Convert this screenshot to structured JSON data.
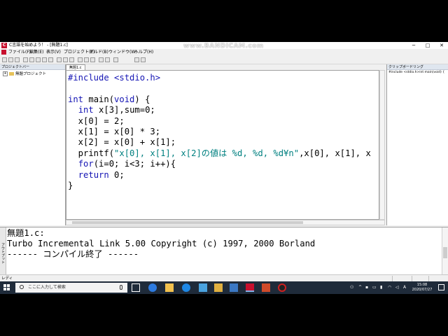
{
  "window": {
    "title": "C言語を始めよう！ - [無題1.c]",
    "app_icon_letter": "C",
    "minimize": "─",
    "maximize": "□",
    "close": "✕"
  },
  "watermark": "www.BANDICAM.com",
  "menu": {
    "items": [
      {
        "label": "ファイル(F)"
      },
      {
        "label": "編集(E)"
      },
      {
        "label": "表示(V)"
      },
      {
        "label": "プロジェクト(P)"
      },
      {
        "label": "ビルド(B)"
      },
      {
        "label": "ウィンドウ(W)"
      },
      {
        "label": "ヘルプ(H)"
      }
    ]
  },
  "left_panel": {
    "header": "プロジェクトバー",
    "tree_expander": "+",
    "tree_item": "無題プロジェクト"
  },
  "right_panel": {
    "header": "クリップボードリング",
    "item": "#include <stdio.h>int main(void) {"
  },
  "editor": {
    "tab": "無題1.c",
    "code": [
      [
        {
          "t": "#include <stdio.h>",
          "c": "kw"
        }
      ],
      [
        {
          "t": ""
        }
      ],
      [
        {
          "t": "int",
          "c": "kw"
        },
        {
          "t": " main("
        },
        {
          "t": "void",
          "c": "kw"
        },
        {
          "t": ") {"
        }
      ],
      [
        {
          "t": "  "
        },
        {
          "t": "int",
          "c": "kw"
        },
        {
          "t": " x[3],sum=0;"
        }
      ],
      [
        {
          "t": "  x[0] = 2;"
        }
      ],
      [
        {
          "t": "  x[1] = x[0] * 3;"
        }
      ],
      [
        {
          "t": "  x[2] = x[0] + x[1];"
        }
      ],
      [
        {
          "t": "  printf("
        },
        {
          "t": "\"x[0], x[1], x[2]の値は %d, %d, %d¥n\"",
          "c": "str"
        },
        {
          "t": ",x[0], x[1], x"
        }
      ],
      [
        {
          "t": "  "
        },
        {
          "t": "for",
          "c": "kw"
        },
        {
          "t": "(i=0; i<3; i++){"
        }
      ],
      [
        {
          "t": "  "
        },
        {
          "t": "return",
          "c": "kw"
        },
        {
          "t": " 0;"
        }
      ],
      [
        {
          "t": "}"
        }
      ]
    ]
  },
  "output": {
    "side_label": "アウトプット",
    "lines": [
      "無題1.c:",
      "Turbo Incremental Link 5.00 Copyright (c) 1997, 2000 Borland",
      "------ コンパイル終了 ------"
    ]
  },
  "status": {
    "text": "レディ"
  },
  "taskbar": {
    "search_placeholder": "ここに入力して検索",
    "ime": "A",
    "time": "15:08",
    "date": "2020/07/27"
  },
  "colors": {
    "keyword": "#1414b4",
    "string": "#008080",
    "taskbar": "#1f2b3a"
  }
}
